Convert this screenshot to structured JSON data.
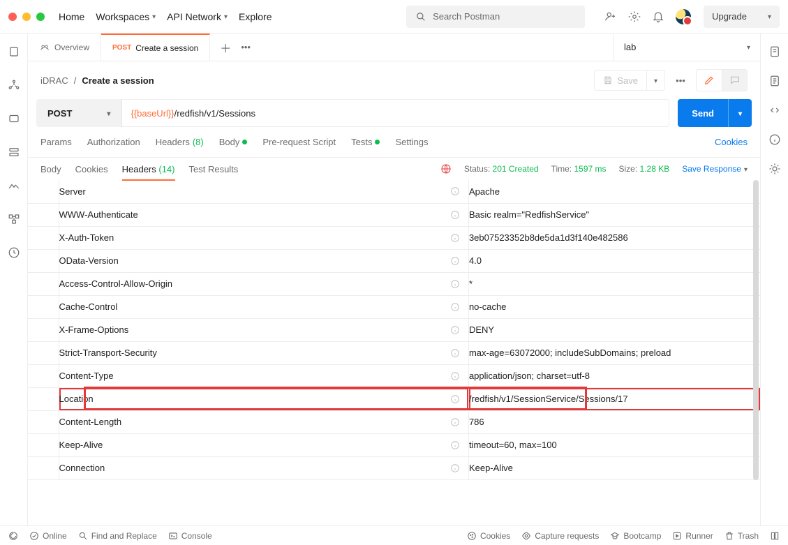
{
  "nav": {
    "home": "Home",
    "workspaces": "Workspaces",
    "api_network": "API Network",
    "explore": "Explore"
  },
  "search": {
    "placeholder": "Search Postman"
  },
  "upgrade": "Upgrade",
  "tabs": {
    "overview": "Overview",
    "request": {
      "method": "POST",
      "title": "Create a session"
    }
  },
  "environment": "lab",
  "breadcrumb": {
    "root": "iDRAC",
    "current": "Create a session"
  },
  "actions": {
    "save": "Save"
  },
  "request": {
    "method": "POST",
    "url_var": "{{baseUrl}}",
    "url_path": "/redfish/v1/Sessions",
    "send": "Send"
  },
  "reqtabs": {
    "params": "Params",
    "auth": "Authorization",
    "headers": "Headers",
    "headers_count": "(8)",
    "body": "Body",
    "prereq": "Pre-request Script",
    "tests": "Tests",
    "settings": "Settings",
    "cookies": "Cookies"
  },
  "restabs": {
    "body": "Body",
    "cookies": "Cookies",
    "headers": "Headers",
    "headers_count": "(14)",
    "tests": "Test Results"
  },
  "status": {
    "status_label": "Status:",
    "status_value": "201 Created",
    "time_label": "Time:",
    "time_value": "1597 ms",
    "size_label": "Size:",
    "size_value": "1.28 KB",
    "save_response": "Save Response"
  },
  "headers": [
    {
      "k": "Server",
      "v": "Apache"
    },
    {
      "k": "WWW-Authenticate",
      "v": "Basic realm=\"RedfishService\""
    },
    {
      "k": "X-Auth-Token",
      "v": "3eb07523352b8de5da1d3f140e482586"
    },
    {
      "k": "OData-Version",
      "v": "4.0"
    },
    {
      "k": "Access-Control-Allow-Origin",
      "v": "*"
    },
    {
      "k": "Cache-Control",
      "v": "no-cache"
    },
    {
      "k": "X-Frame-Options",
      "v": "DENY"
    },
    {
      "k": "Strict-Transport-Security",
      "v": "max-age=63072000; includeSubDomains; preload"
    },
    {
      "k": "Content-Type",
      "v": "application/json; charset=utf-8"
    },
    {
      "k": "Location",
      "v": "/redfish/v1/SessionService/Sessions/17",
      "hl": true
    },
    {
      "k": "Content-Length",
      "v": "786"
    },
    {
      "k": "Keep-Alive",
      "v": "timeout=60, max=100"
    },
    {
      "k": "Connection",
      "v": "Keep-Alive"
    }
  ],
  "footer": {
    "online": "Online",
    "find": "Find and Replace",
    "console": "Console",
    "cookies": "Cookies",
    "capture": "Capture requests",
    "bootcamp": "Bootcamp",
    "runner": "Runner",
    "trash": "Trash"
  }
}
